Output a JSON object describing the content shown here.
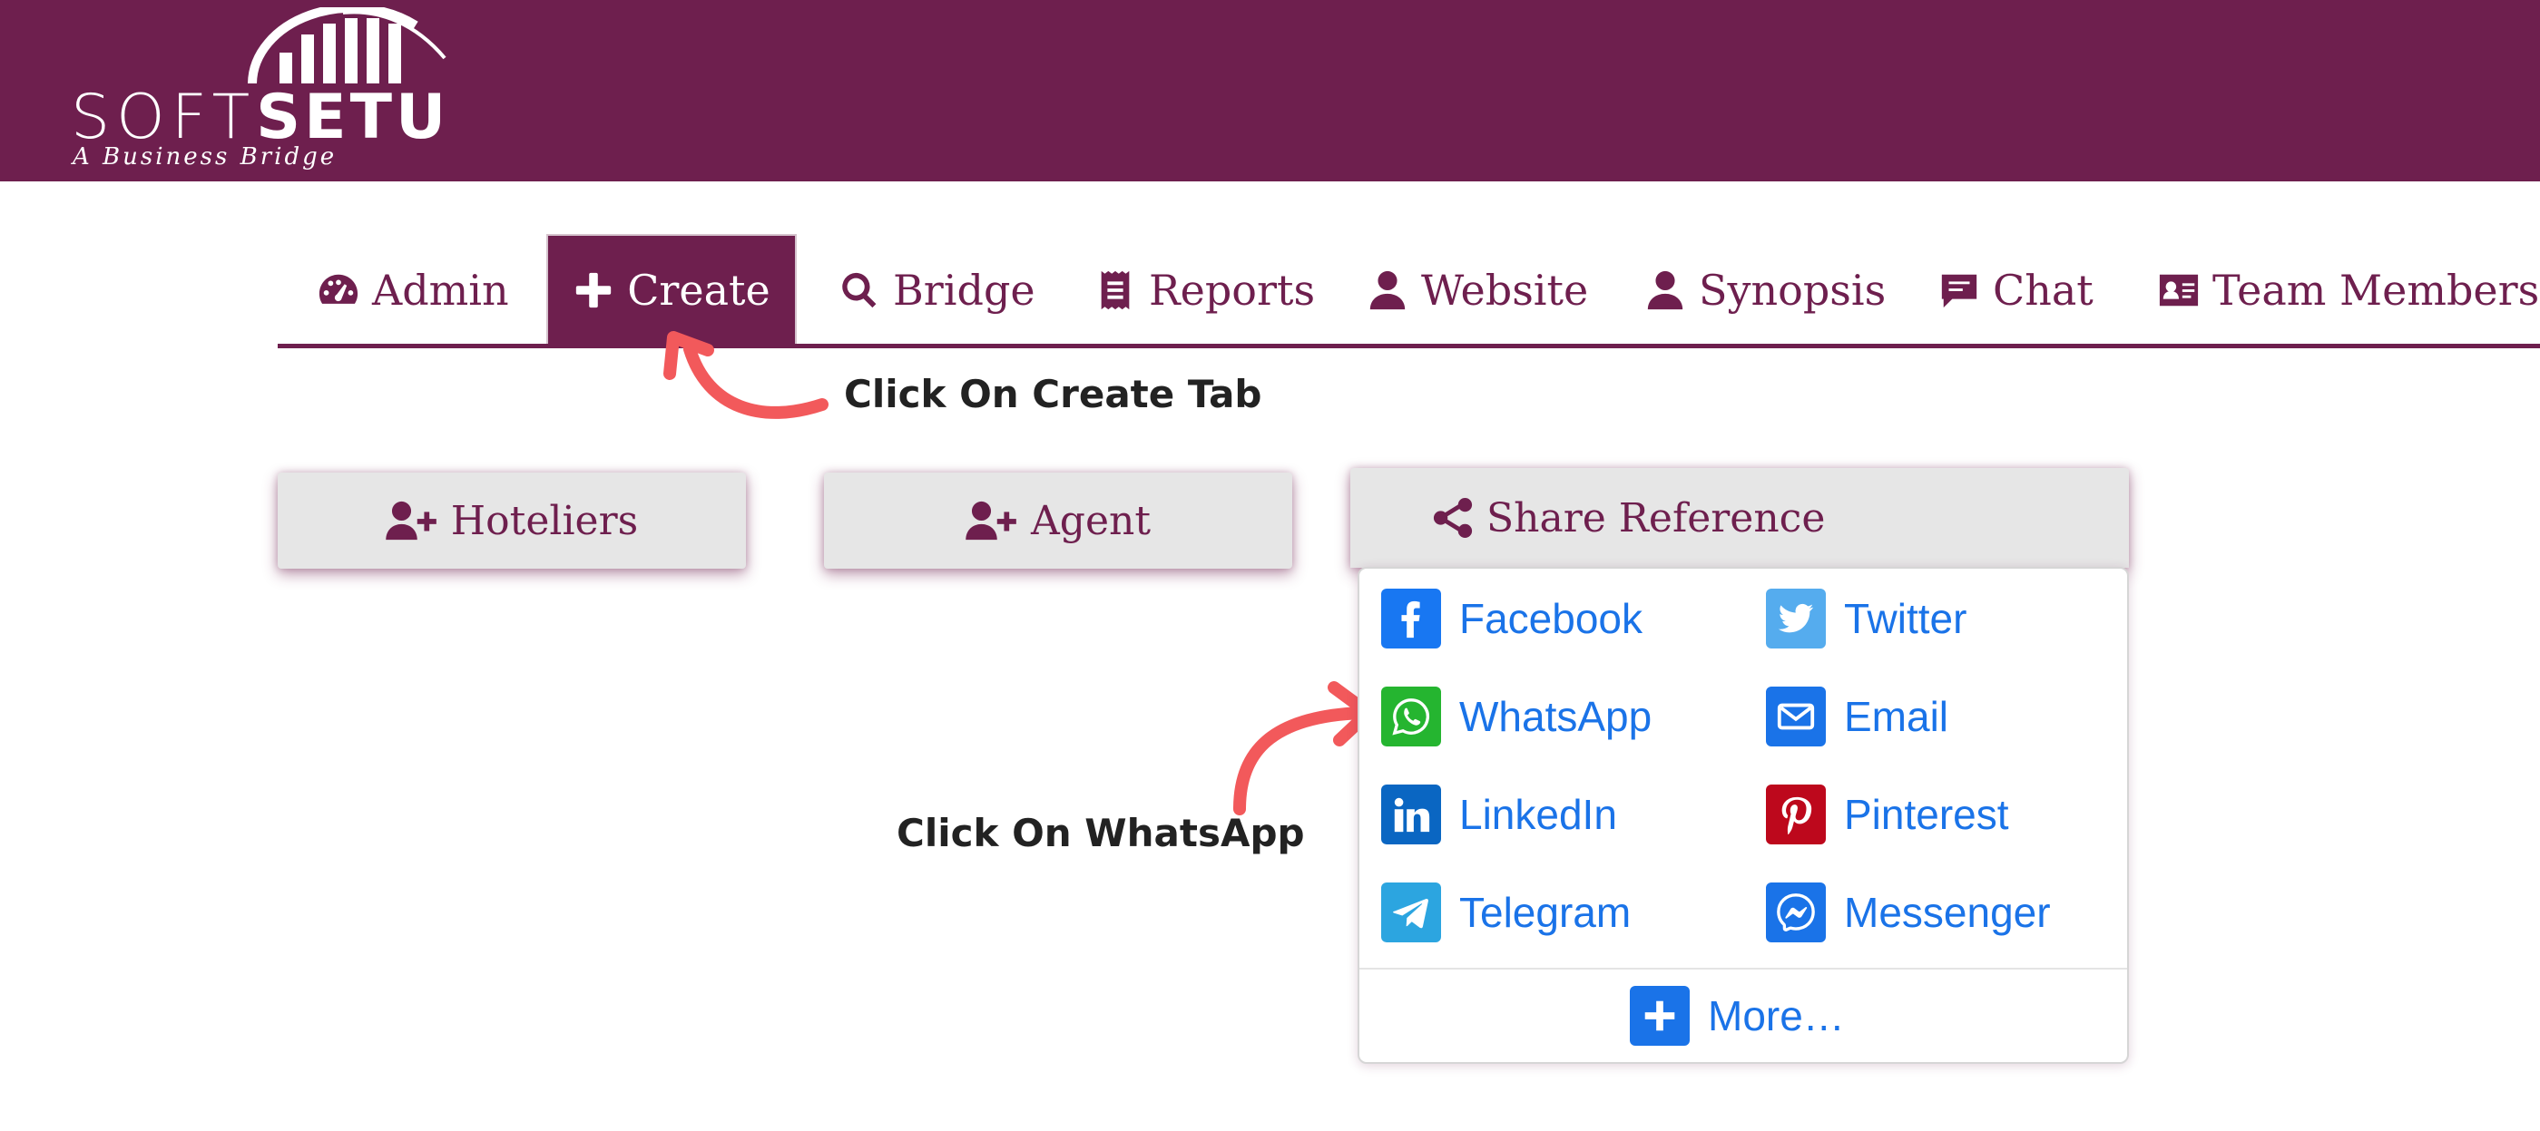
{
  "brand": {
    "name_light": "SOFT",
    "name_bold": "SETU",
    "tagline": "A Business Bridge"
  },
  "nav": {
    "tabs": [
      {
        "label": "Admin",
        "icon": "dashboard-icon"
      },
      {
        "label": "Create",
        "icon": "plus-icon",
        "active": true
      },
      {
        "label": "Bridge",
        "icon": "search-icon"
      },
      {
        "label": "Reports",
        "icon": "receipt-icon"
      },
      {
        "label": "Website",
        "icon": "user-icon"
      },
      {
        "label": "Synopsis",
        "icon": "user-icon"
      },
      {
        "label": "Chat",
        "icon": "chat-icon"
      },
      {
        "label": "Team Members",
        "icon": "id-card-icon"
      }
    ]
  },
  "annotations": {
    "create_tab": "Click On Create Tab",
    "whatsapp": "Click On WhatsApp",
    "arrow_color": "#f2595b"
  },
  "actions": {
    "hoteliers": "Hoteliers",
    "agent": "Agent",
    "share_reference": "Share Reference"
  },
  "share_menu": {
    "items": [
      {
        "label": "Facebook",
        "color": "#1877f2",
        "icon": "facebook-icon"
      },
      {
        "label": "Twitter",
        "color": "#55acee",
        "icon": "twitter-icon"
      },
      {
        "label": "WhatsApp",
        "color": "#25b530",
        "icon": "whatsapp-icon"
      },
      {
        "label": "Email",
        "color": "#1a73e8",
        "icon": "email-icon"
      },
      {
        "label": "LinkedIn",
        "color": "#0a66c2",
        "icon": "linkedin-icon"
      },
      {
        "label": "Pinterest",
        "color": "#bd081c",
        "icon": "pinterest-icon"
      },
      {
        "label": "Telegram",
        "color": "#2ca5e0",
        "icon": "telegram-icon"
      },
      {
        "label": "Messenger",
        "color": "#1a73e8",
        "icon": "messenger-icon"
      }
    ],
    "more": "More…"
  },
  "colors": {
    "brand": "#6e1f4e",
    "link": "#1a73e8",
    "button_bg": "#e6e6e6"
  }
}
